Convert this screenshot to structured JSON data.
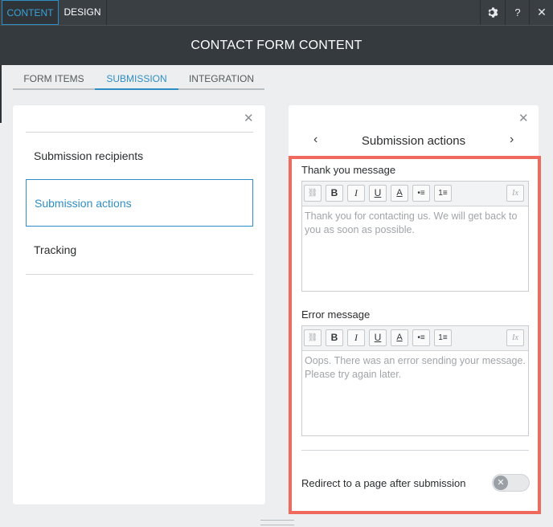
{
  "top_tabs": [
    {
      "label": "CONTENT",
      "active": true
    },
    {
      "label": "DESIGN",
      "active": false
    }
  ],
  "top_icons": [
    "gear-icon",
    "help-icon",
    "close-icon"
  ],
  "top_icon_glyphs": {
    "help": "?",
    "close": "✕"
  },
  "header": {
    "title": "CONTACT FORM CONTENT"
  },
  "sub_tabs": [
    {
      "label": "FORM ITEMS",
      "active": false
    },
    {
      "label": "SUBMISSION",
      "active": true
    },
    {
      "label": "INTEGRATION",
      "active": false
    }
  ],
  "left_panel": {
    "items": [
      {
        "label": "Submission recipients",
        "selected": false
      },
      {
        "label": "Submission actions",
        "selected": true
      },
      {
        "label": "Tracking",
        "selected": false
      }
    ]
  },
  "right_panel": {
    "title": "Submission actions",
    "thank_you": {
      "label": "Thank you message",
      "text": "Thank you for contacting us. We will get back to you as soon as possible."
    },
    "error": {
      "label": "Error message",
      "text": "Oops. There was an error sending your message. Please try again later."
    },
    "redirect_label": "Redirect to a page after submission",
    "redirect_enabled": false
  },
  "toolbar_buttons": [
    {
      "icon": "link-icon",
      "glyph": "⛓"
    },
    {
      "icon": "bold-icon",
      "glyph": "B"
    },
    {
      "icon": "italic-icon",
      "glyph": "I"
    },
    {
      "icon": "underline-icon",
      "glyph": "U"
    },
    {
      "icon": "text-color-icon",
      "glyph": "A"
    },
    {
      "icon": "bullet-list-icon",
      "glyph": "•≡"
    },
    {
      "icon": "numbered-list-icon",
      "glyph": "1≡"
    },
    {
      "icon": "clear-format-icon",
      "glyph": "Ix"
    }
  ],
  "colors": {
    "accent": "#2f8fc4",
    "highlight_border": "#ef6a5c",
    "topbar": "#3a3f44"
  }
}
